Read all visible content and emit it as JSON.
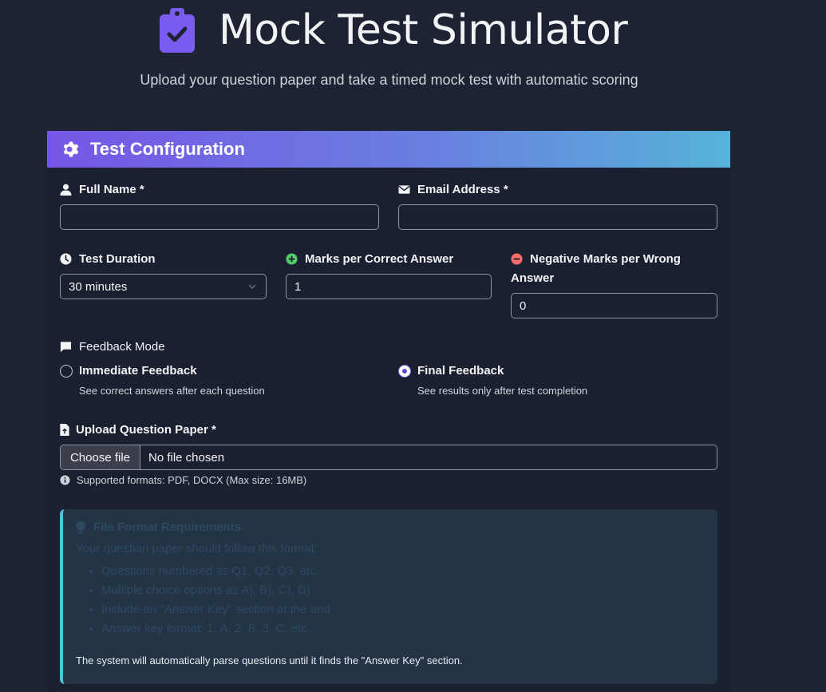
{
  "header": {
    "title": "Mock Test Simulator",
    "subtitle": "Upload your question paper and take a timed mock test with automatic scoring",
    "icon": "clipboard-check-icon",
    "icon_color": "#7b5cf0"
  },
  "card": {
    "title": "Test Configuration",
    "header_gradient": [
      "#7656e6",
      "#56b3d9"
    ]
  },
  "form": {
    "full_name": {
      "label": "Full Name *",
      "value": ""
    },
    "email": {
      "label": "Email Address *",
      "value": ""
    },
    "duration": {
      "label": "Test Duration",
      "selected": "30 minutes"
    },
    "marks_correct": {
      "label": "Marks per Correct Answer",
      "value": "1",
      "icon_color": "#51cf66"
    },
    "negative_marks": {
      "label_line1": "Negative Marks per Wrong",
      "label_line2": "Answer",
      "value": "0",
      "icon_color": "#ff6b6b"
    },
    "feedback": {
      "label": "Feedback Mode",
      "options": [
        {
          "label": "Immediate Feedback",
          "help": "See correct answers after each question",
          "checked": false
        },
        {
          "label": "Final Feedback",
          "help": "See results only after test completion",
          "checked": true
        }
      ]
    },
    "upload": {
      "label": "Upload Question Paper *",
      "button": "Choose file",
      "file_name": "No file chosen",
      "hint": "Supported formats: PDF, DOCX (Max size: 16MB)"
    }
  },
  "requirements": {
    "title": "File Format Requirements",
    "intro": "Your question paper should follow this format:",
    "items": [
      "Questions numbered as Q1, Q2, Q3, etc.",
      "Multiple choice options as A), B), C), D)",
      "Include an \"Answer Key\" section at the end",
      "Answer key format: 1. A, 2. B, 3. C, etc."
    ],
    "footer": "The system will automatically parse questions until it finds the \"Answer Key\" section.",
    "accent": "#4fc3dc"
  }
}
